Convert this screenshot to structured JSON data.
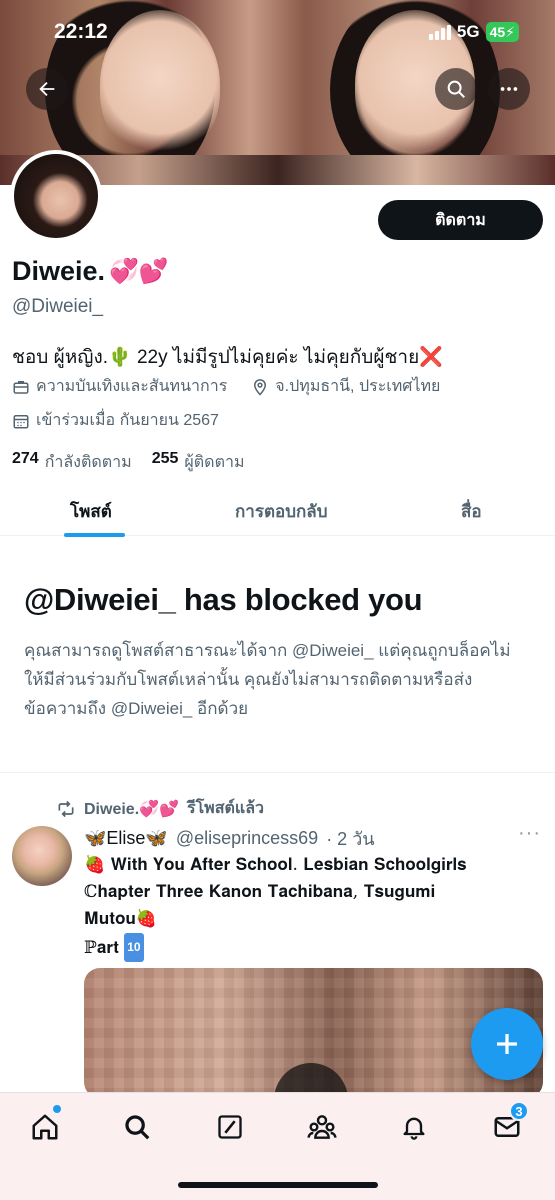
{
  "status_bar": {
    "time": "22:12",
    "network": "5G",
    "battery": "45"
  },
  "profile": {
    "display_name": "Diweie.",
    "name_emoji": "💞💕",
    "handle": "@Diweiei_",
    "follow_label": "ติดตาม",
    "bio_text": "ชอบ ผู้หญิง.🌵 22y ไม่มีรูปไม่คุยค่ะ ไม่คุยกับผู้ชาย",
    "bio_end_mark": "❌",
    "category": "ความบันเทิงและสันทนาการ",
    "location": "จ.ปทุมธานี, ประเทศไทย",
    "joined": "เข้าร่วมเมื่อ กันยายน 2567",
    "following_count": "274",
    "following_label": "กำลังติดตาม",
    "followers_count": "255",
    "followers_label": "ผู้ติดตาม"
  },
  "tabs": [
    {
      "label": "โพสต์",
      "active": true
    },
    {
      "label": "การตอบกลับ",
      "active": false
    },
    {
      "label": "สื่อ",
      "active": false
    }
  ],
  "blocked": {
    "title": "@Diweiei_ has blocked you",
    "message": "คุณสามารถดูโพสต์สาธารณะได้จาก @Diweiei_ แต่คุณถูกบล็อคไม่ให้มีส่วนร่วมกับโพสต์เหล่านั้น คุณยังไม่สามารถติดตามหรือส่งข้อความถึง @Diweiei_ อีกด้วย"
  },
  "post": {
    "repost_by": "Diweie.💞💕",
    "repost_label": "รีโพสต์แล้ว",
    "author": "🦋Elise🦋",
    "author_handle": "@eliseprincess69",
    "time": "· 2 วัน",
    "more": "···",
    "text_line1": "𝐖𝐢𝐭𝐡 𝐘𝐨𝐮 𝐀𝐟𝐭𝐞𝐫 𝐒𝐜𝐡𝐨𝐨𝐥. 𝐋𝐞𝐬𝐛𝐢𝐚𝐧 𝐒𝐜𝐡𝐨𝐨𝐥𝐠𝐢𝐫𝐥𝐬",
    "text_line2": "ℂ𝐡𝐚𝐩𝐭𝐞𝐫 𝐓𝐡𝐫𝐞𝐞 𝐊𝐚𝐧𝐨𝐧 𝐓𝐚𝐜𝐡𝐢𝐛𝐚𝐧𝐚, 𝐓𝐬𝐮𝐠𝐮𝐦𝐢",
    "text_line3": "𝐌𝐮𝐭𝐨𝐮",
    "text_line4": "ℙ𝐚𝐫𝐭",
    "part_number": "10",
    "strawberry": "🍓"
  },
  "nav": {
    "messages_badge": "3"
  },
  "colors": {
    "accent": "#1d9bf0",
    "text": "#0f1419",
    "muted": "#536471"
  }
}
